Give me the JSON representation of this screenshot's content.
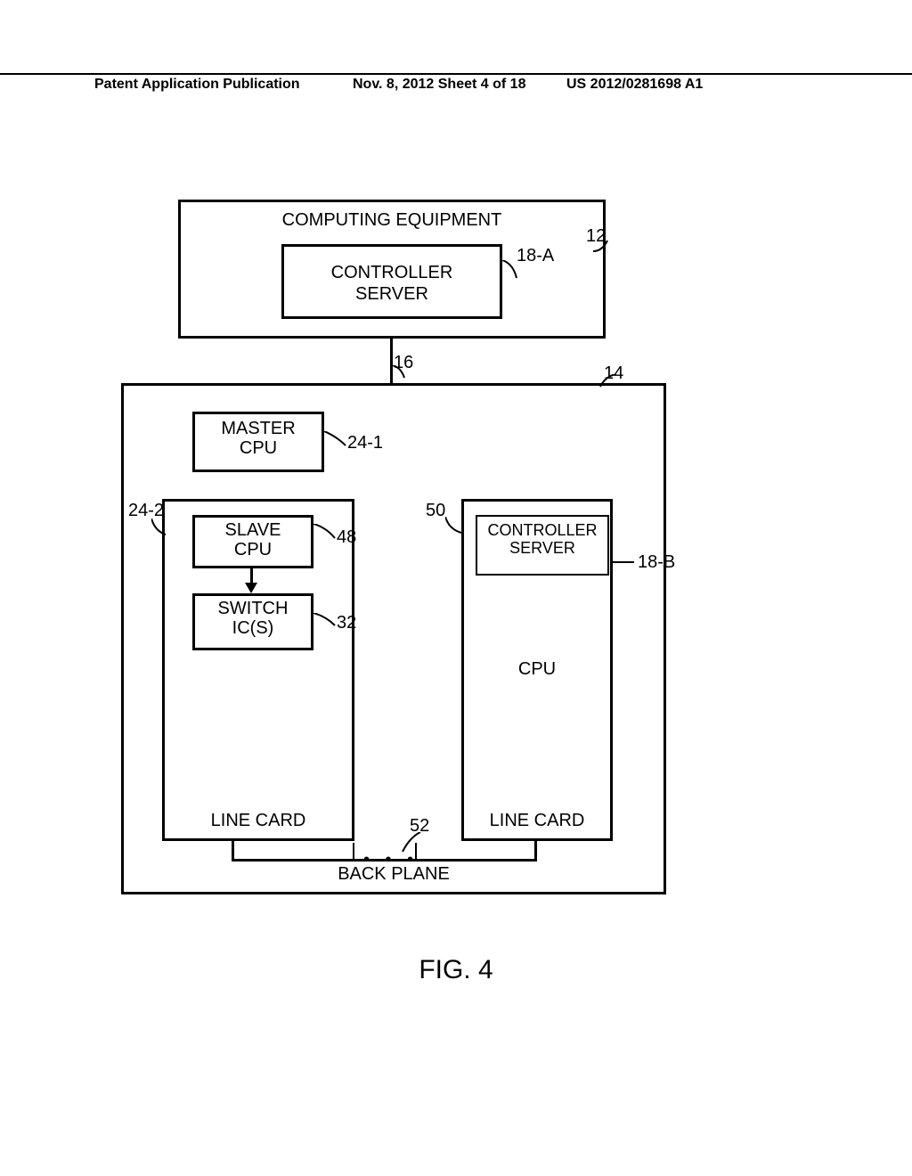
{
  "header": {
    "left": "Patent Application Publication",
    "middle": "Nov. 8, 2012  Sheet 4 of 18",
    "right": "US 2012/0281698 A1"
  },
  "figure": {
    "caption": "FIG. 4",
    "computing_equipment": {
      "title": "COMPUTING EQUIPMENT",
      "ref": "12",
      "controller_server": {
        "label_line1": "CONTROLLER",
        "label_line2": "SERVER",
        "ref": "18-A"
      }
    },
    "link_ref": "16",
    "switch": {
      "ref": "14",
      "master_cpu": {
        "label_line1": "MASTER",
        "label_line2": "CPU",
        "ref": "24-1"
      },
      "line_card_left": {
        "ref": "24-2",
        "line_card_ref_inner": "48",
        "slave_cpu": {
          "label_line1": "SLAVE",
          "label_line2": "CPU"
        },
        "switch_ic": {
          "label_line1": "SWITCH",
          "label_line2": "IC(S)",
          "ref": "32"
        },
        "label": "LINE CARD"
      },
      "line_card_right": {
        "ref": "50",
        "controller_server": {
          "label_line1": "CONTROLLER",
          "label_line2": "SERVER",
          "ref": "18-B"
        },
        "cpu_label": "CPU",
        "label": "LINE CARD"
      },
      "back_plane": {
        "label": "BACK PLANE",
        "ref": "52"
      }
    }
  }
}
